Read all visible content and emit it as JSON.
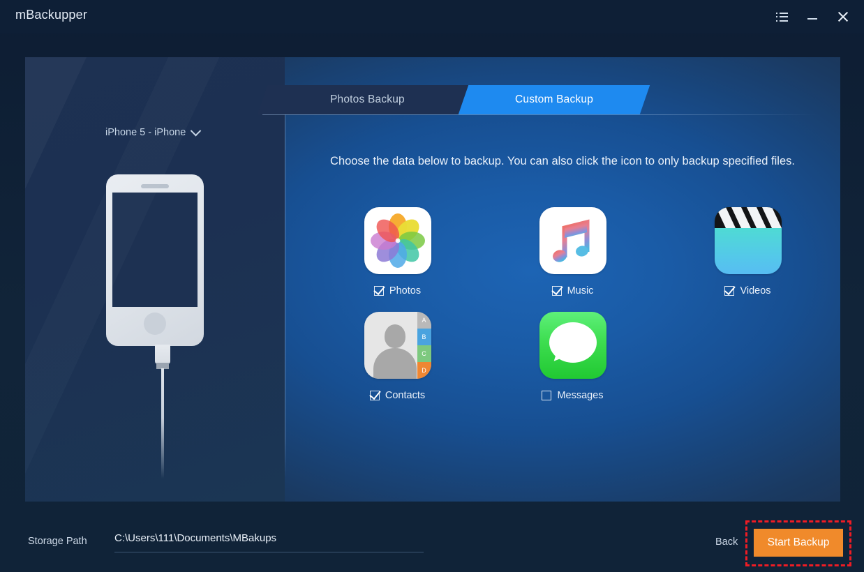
{
  "window": {
    "title": "mBackupper",
    "controls": [
      {
        "name": "menu-icon",
        "label": "menu"
      },
      {
        "name": "minimize-icon",
        "label": "minimize"
      },
      {
        "name": "close-icon",
        "label": "close"
      }
    ]
  },
  "device": {
    "selected": "iPhone 5 - iPhone",
    "chevron": "chevron-down-icon"
  },
  "tabs": [
    {
      "label": "Photos Backup",
      "active": false
    },
    {
      "label": "Custom Backup",
      "active": true
    }
  ],
  "instruction": "Choose the data below to backup. You can also click the icon to only backup specified files.",
  "items": [
    {
      "id": "photos",
      "label": "Photos",
      "checked": true,
      "icon": "photos-icon"
    },
    {
      "id": "music",
      "label": "Music",
      "checked": true,
      "icon": "music-icon"
    },
    {
      "id": "videos",
      "label": "Videos",
      "checked": true,
      "icon": "videos-icon"
    },
    {
      "id": "contacts",
      "label": "Contacts",
      "checked": true,
      "icon": "contacts-icon"
    },
    {
      "id": "messages",
      "label": "Messages",
      "checked": false,
      "icon": "messages-icon"
    }
  ],
  "contacts_icon_tabs": [
    "A",
    "B",
    "C",
    "D"
  ],
  "footer": {
    "storage_label": "Storage Path",
    "storage_path": "C:\\Users\\111\\Documents\\MBakups",
    "back_label": "Back",
    "start_label": "Start Backup"
  },
  "colors": {
    "accent_blue": "#1e8af0",
    "action_orange": "#f08a2b",
    "highlight_red": "#ef1c24",
    "titlebar": "#0e1f36",
    "panel_dark": "#1d3152"
  }
}
